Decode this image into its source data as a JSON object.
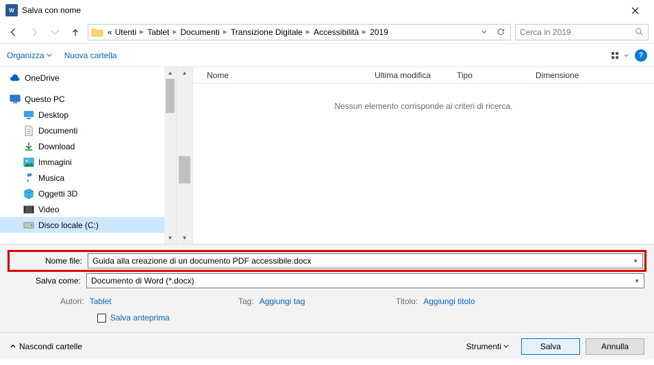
{
  "window": {
    "title": "Salva con nome"
  },
  "breadcrumbs": {
    "prefix": "«",
    "items": [
      "Utenti",
      "Tablet",
      "Documenti",
      "Transizione Digitale",
      "Accessibilità",
      "2019"
    ]
  },
  "search": {
    "placeholder": "Cerca in 2019"
  },
  "toolbar": {
    "organize": "Organizza",
    "new_folder": "Nuova cartella"
  },
  "columns": {
    "name": "Nome",
    "modified": "Ultima modifica",
    "type": "Tipo",
    "size": "Dimensione"
  },
  "empty_message": "Nessun elemento corrisponde ai criteri di ricerca.",
  "tree": {
    "onedrive": "OneDrive",
    "thispc": "Questo PC",
    "desktop": "Desktop",
    "documents": "Documenti",
    "downloads": "Download",
    "pictures": "Immagini",
    "music": "Musica",
    "objects3d": "Oggetti 3D",
    "videos": "Video",
    "localdisk": "Disco locale (C:)"
  },
  "form": {
    "filename_label": "Nome file:",
    "filename_value": "Guida alla creazione di un documento PDF accessibile.docx",
    "saveas_label": "Salva come:",
    "saveas_value": "Documento di Word (*.docx)",
    "authors_label": "Autori:",
    "authors_value": "Tablet",
    "tag_label": "Tag:",
    "tag_placeholder": "Aggiungi tag",
    "title_label": "Titolo:",
    "title_placeholder": "Aggiungi titolo",
    "save_preview": "Salva anteprima"
  },
  "footer": {
    "hide_folders": "Nascondi cartelle",
    "tools": "Strumenti",
    "save": "Salva",
    "cancel": "Annulla"
  }
}
